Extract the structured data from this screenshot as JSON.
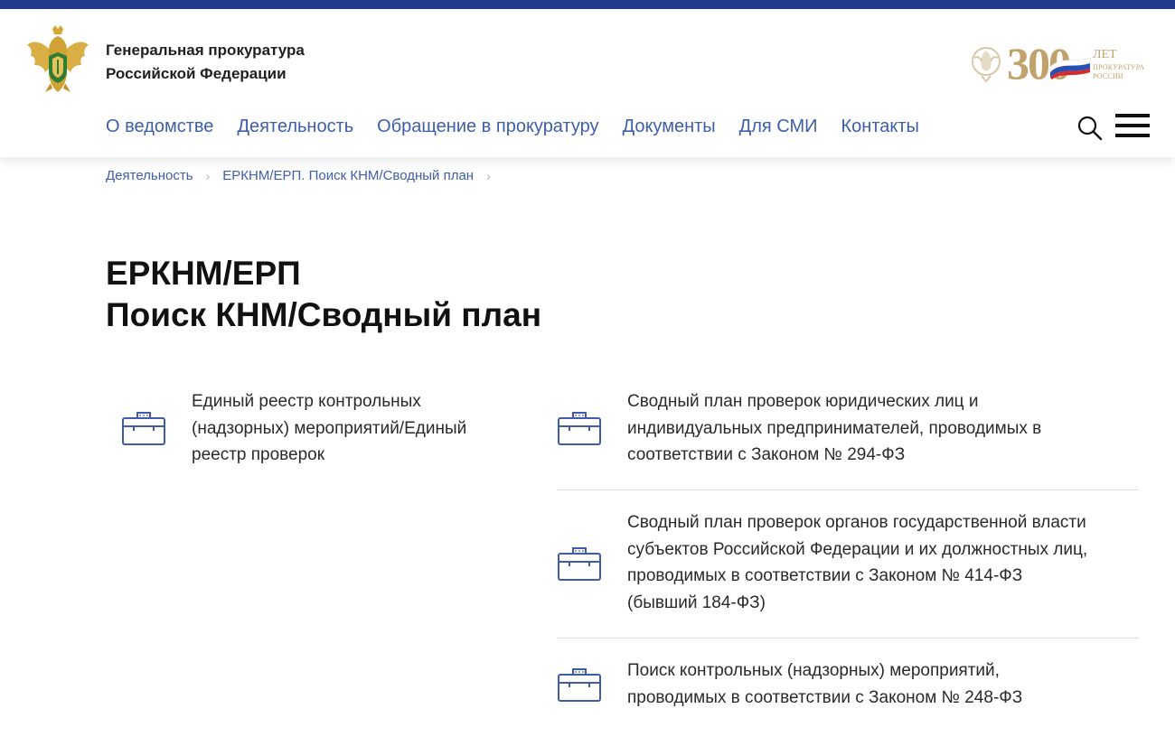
{
  "header": {
    "org_line1": "Генеральная прокуратура",
    "org_line2": "Российской Федерации",
    "badge_number": "300",
    "badge_years": "ЛЕТ",
    "badge_sub1": "ПРОКУРАТУРА",
    "badge_sub2": "РОССИИ"
  },
  "nav": {
    "items": [
      "О ведомстве",
      "Деятельность",
      "Обращение в прокуратуру",
      "Документы",
      "Для СМИ",
      "Контакты"
    ]
  },
  "breadcrumb": {
    "items": [
      "Деятельность",
      "ЕРКНМ/ЕРП. Поиск КНМ/Сводный план"
    ],
    "separator": "›"
  },
  "page": {
    "title_line1": "ЕРКНМ/ЕРП",
    "title_line2": "Поиск КНМ/Сводный план"
  },
  "cards": [
    {
      "lines": [
        "Единый реестр контрольных",
        "(надзорных) мероприятий/Единый",
        "реестр проверок"
      ],
      "icon": "briefcase-icon"
    },
    {
      "lines": [
        "Сводный план проверок юридических лиц и",
        "индивидуальных предпринимателей, проводимых в",
        "соответствии с Законом № 294-ФЗ"
      ],
      "icon": "briefcase-icon"
    },
    {
      "lines": [
        "Сводный план проверок органов государственной власти",
        "субъектов Российской Федерации и их должностных лиц,",
        "проводимых в соответствии с Законом № 414-ФЗ",
        "(бывший 184-ФЗ)"
      ],
      "icon": "briefcase-icon"
    },
    {
      "lines": [
        "Поиск контрольных (надзорных) мероприятий,",
        "проводимых в соответствии с Законом № 248-ФЗ"
      ],
      "icon": "briefcase-icon"
    }
  ],
  "colors": {
    "top_bar": "#233a8b",
    "link": "#3d5eab",
    "icon_stroke": "#3f5bab",
    "gold": "#c2a26c"
  }
}
